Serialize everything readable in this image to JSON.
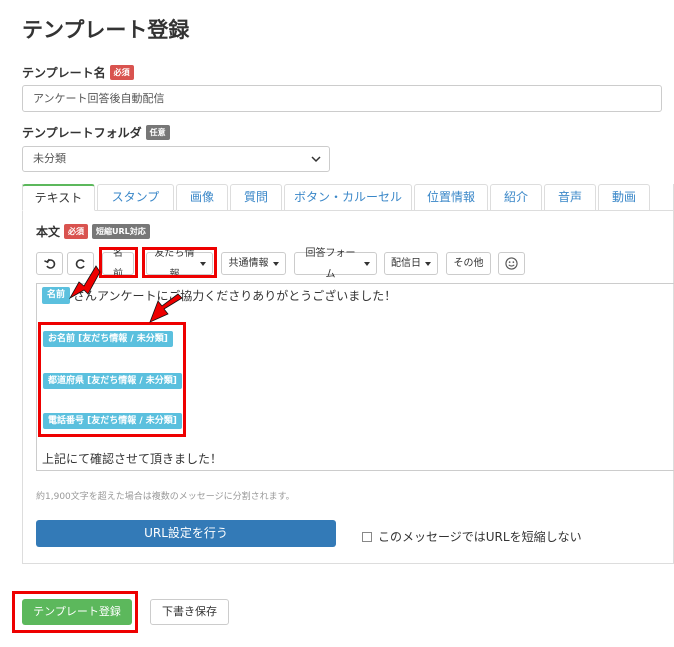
{
  "page": {
    "title": "テンプレート登録"
  },
  "form": {
    "name_label": "テンプレート名",
    "name_badge": "必須",
    "name_value": "アンケート回答後自動配信",
    "folder_label": "テンプレートフォルダ",
    "folder_badge": "任意",
    "folder_value": "未分類"
  },
  "tabs": [
    "テキスト",
    "スタンプ",
    "画像",
    "質問",
    "ボタン・カルーセル",
    "位置情報",
    "紹介",
    "音声",
    "動画"
  ],
  "body": {
    "label": "本文",
    "required_badge": "必須",
    "short_url_badge": "短縮URL対応"
  },
  "toolbar": {
    "name_btn": "名前",
    "friend_info": "友だち情報",
    "common_info": "共通情報",
    "answer_form": "回答フォーム",
    "delivery_date": "配信日",
    "other": "その他"
  },
  "editor": {
    "name_tag": "名前",
    "line1": "さんアンケートにご協力くださりありがとうございました！",
    "tag1": "お名前 [友だち情報 / 未分類]",
    "tag2": "都道府県 [友だち情報 / 未分類]",
    "tag3": "電話番号 [友だち情報 / 未分類]",
    "last_line": "上記にて確認させて頂きました！"
  },
  "hint": "約1,900文字を超えた場合は複数のメッセージに分割されます。",
  "url_button": "URL設定を行う",
  "no_shorten_label": "このメッセージではURLを短縮しない",
  "actions": {
    "submit": "テンプレート登録",
    "draft": "下書き保存"
  },
  "colors": {
    "highlight": "#e00000",
    "tag": "#5bc0de",
    "primary": "#337ab7",
    "success": "#5cb85c"
  }
}
